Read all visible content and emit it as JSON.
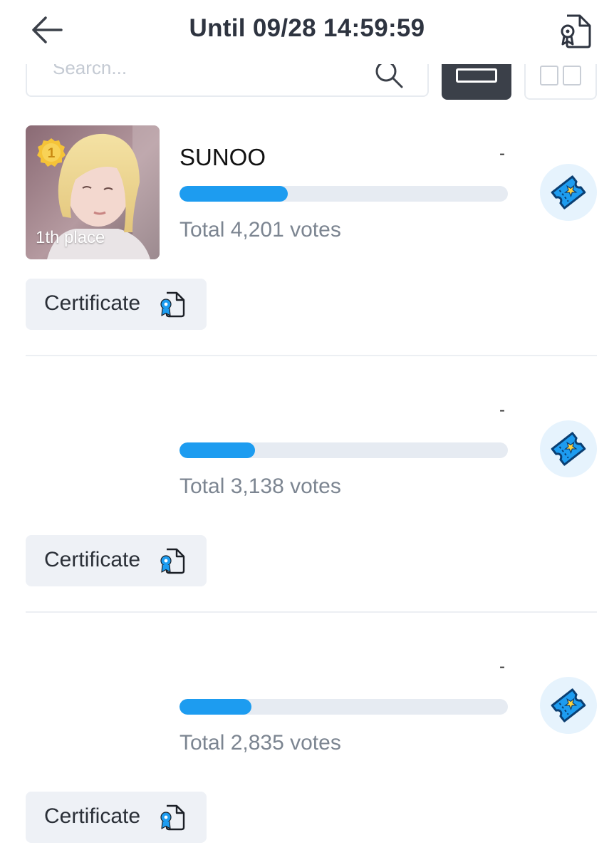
{
  "header": {
    "title": "Until 09/28 14:59:59",
    "back_icon": "arrow-left-icon",
    "certificate_icon": "certificate-document-icon"
  },
  "search": {
    "placeholder": "Search..."
  },
  "colors": {
    "accent": "#1d9cf0",
    "track": "#e6ebf2",
    "vote_bg": "#e6f3fd",
    "cert_bg": "#eef1f6",
    "medal": "#f5c338"
  },
  "ranking": [
    {
      "rank": "1",
      "place_label": "1th place",
      "name": "SUNOO",
      "change": "-",
      "progress": 0.33,
      "votes_text": "Total 4,201 votes",
      "certificate_label": "Certificate"
    },
    {
      "name": "",
      "change": "-",
      "progress": 0.23,
      "votes_text": "Total 3,138 votes",
      "certificate_label": "Certificate"
    },
    {
      "name": "",
      "change": "-",
      "progress": 0.22,
      "votes_text": "Total 2,835 votes",
      "certificate_label": "Certificate"
    }
  ]
}
